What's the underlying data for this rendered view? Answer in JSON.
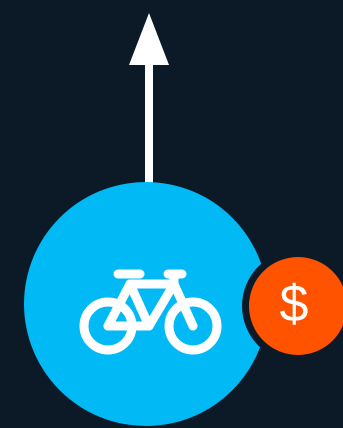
{
  "colors": {
    "background": "#0c1a27",
    "mode_circle": "#00b9f5",
    "fare_badge": "#ff5300",
    "foreground": "#ffffff"
  },
  "icons": {
    "direction": "arrow-up-icon",
    "mode": "bicycle-icon"
  },
  "fare_badge": {
    "symbol": "$"
  }
}
